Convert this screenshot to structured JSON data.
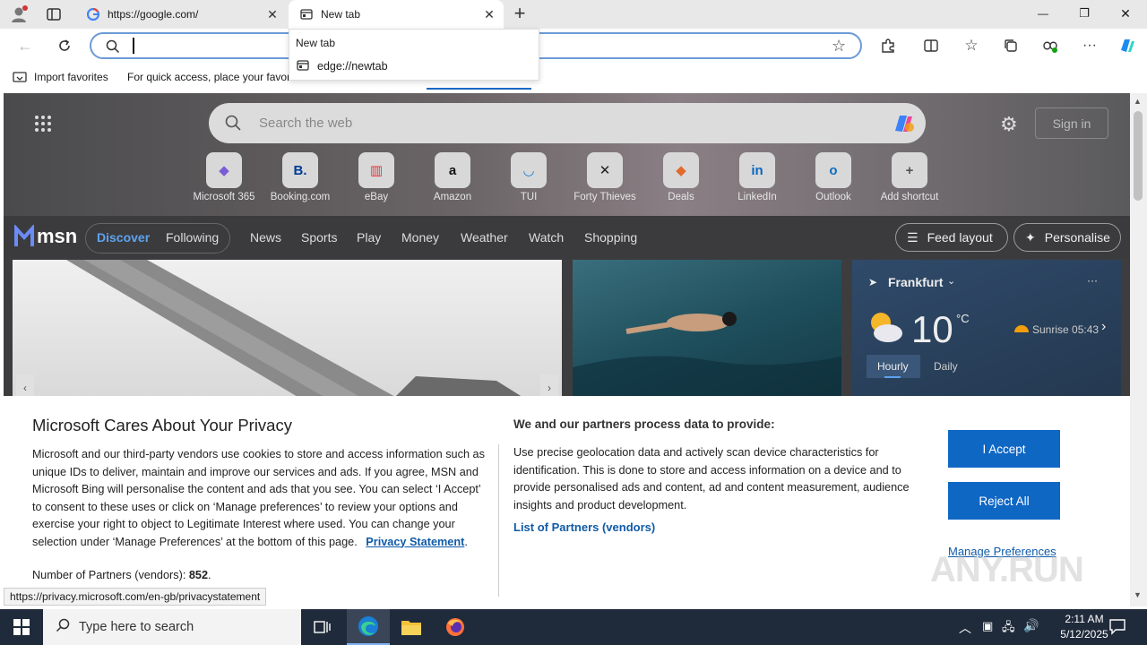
{
  "tabs": [
    {
      "title": "https://google.com/"
    },
    {
      "title": "New tab"
    }
  ],
  "new_tab_button": "+",
  "window_controls": {
    "minimize": "—",
    "restore": "❐",
    "close": "✕"
  },
  "address_bar": {
    "value": "",
    "placeholder": ""
  },
  "dropdown": {
    "header": "New tab",
    "item": "edge://newtab"
  },
  "favorites_bar": {
    "import": "Import favorites",
    "hint": "For quick access, place your favori"
  },
  "newtab": {
    "search_placeholder": "Search the web",
    "sign_in": "Sign in",
    "shortcuts": [
      {
        "label": "Microsoft 365",
        "glyph": "◆",
        "color": "#7b5cd6"
      },
      {
        "label": "Booking.com",
        "glyph": "B.",
        "color": "#003b95"
      },
      {
        "label": "eBay",
        "glyph": "▥",
        "color": "#e53238"
      },
      {
        "label": "Amazon",
        "glyph": "a",
        "color": "#111111"
      },
      {
        "label": "TUI",
        "glyph": "◡",
        "color": "#1a7ed0"
      },
      {
        "label": "Forty Thieves",
        "glyph": "✕",
        "color": "#222222"
      },
      {
        "label": "Deals",
        "glyph": "◆",
        "color": "#e2692c"
      },
      {
        "label": "LinkedIn",
        "glyph": "in",
        "color": "#0a66c2"
      },
      {
        "label": "Outlook",
        "glyph": "o",
        "color": "#0f6cbd"
      },
      {
        "label": "Add shortcut",
        "glyph": "+",
        "color": "#555555"
      }
    ],
    "msn_logo": "msn",
    "nav": [
      "Discover",
      "Following",
      "News",
      "Sports",
      "Play",
      "Money",
      "Weather",
      "Watch",
      "Shopping"
    ],
    "feed_layout": "Feed layout",
    "personalise": "Personalise",
    "weather": {
      "city": "Frankfurt",
      "temp": "10",
      "unit": "°C",
      "sunrise": "Sunrise 05:43",
      "tab_hourly": "Hourly",
      "tab_daily": "Daily",
      "more": "···"
    }
  },
  "privacy": {
    "title": "Microsoft Cares About Your Privacy",
    "body": "Microsoft and our third-party vendors use cookies to store and access information such as unique IDs to deliver, maintain and improve our services and ads. If you agree, MSN and Microsoft Bing will personalise the content and ads that you see. You can select ‘I Accept’ to consent to these uses or click on ‘Manage preferences’ to review your options and exercise your right to object to Legitimate Interest where used.  You can change your selection under ‘Manage Preferences’ at the bottom of this page.",
    "statement_link": "Privacy Statement",
    "partners_label": "Number of Partners (vendors):",
    "partners_count": "852",
    "right_title": "We and our partners process data to provide:",
    "right_body": "Use precise geolocation data and actively scan device characteristics for identification. This is done to store and access information on a device and to provide personalised ads and content, ad and content measurement, audience insights and product development.",
    "list_partners": "List of Partners (vendors)",
    "accept": "I Accept",
    "reject": "Reject All",
    "manage": "Manage Preferences"
  },
  "status_url": "https://privacy.microsoft.com/en-gb/privacystatement",
  "watermark": "ANY.RUN",
  "taskbar": {
    "search_placeholder": "Type here to search",
    "time": "2:11 AM",
    "date": "5/12/2025"
  }
}
